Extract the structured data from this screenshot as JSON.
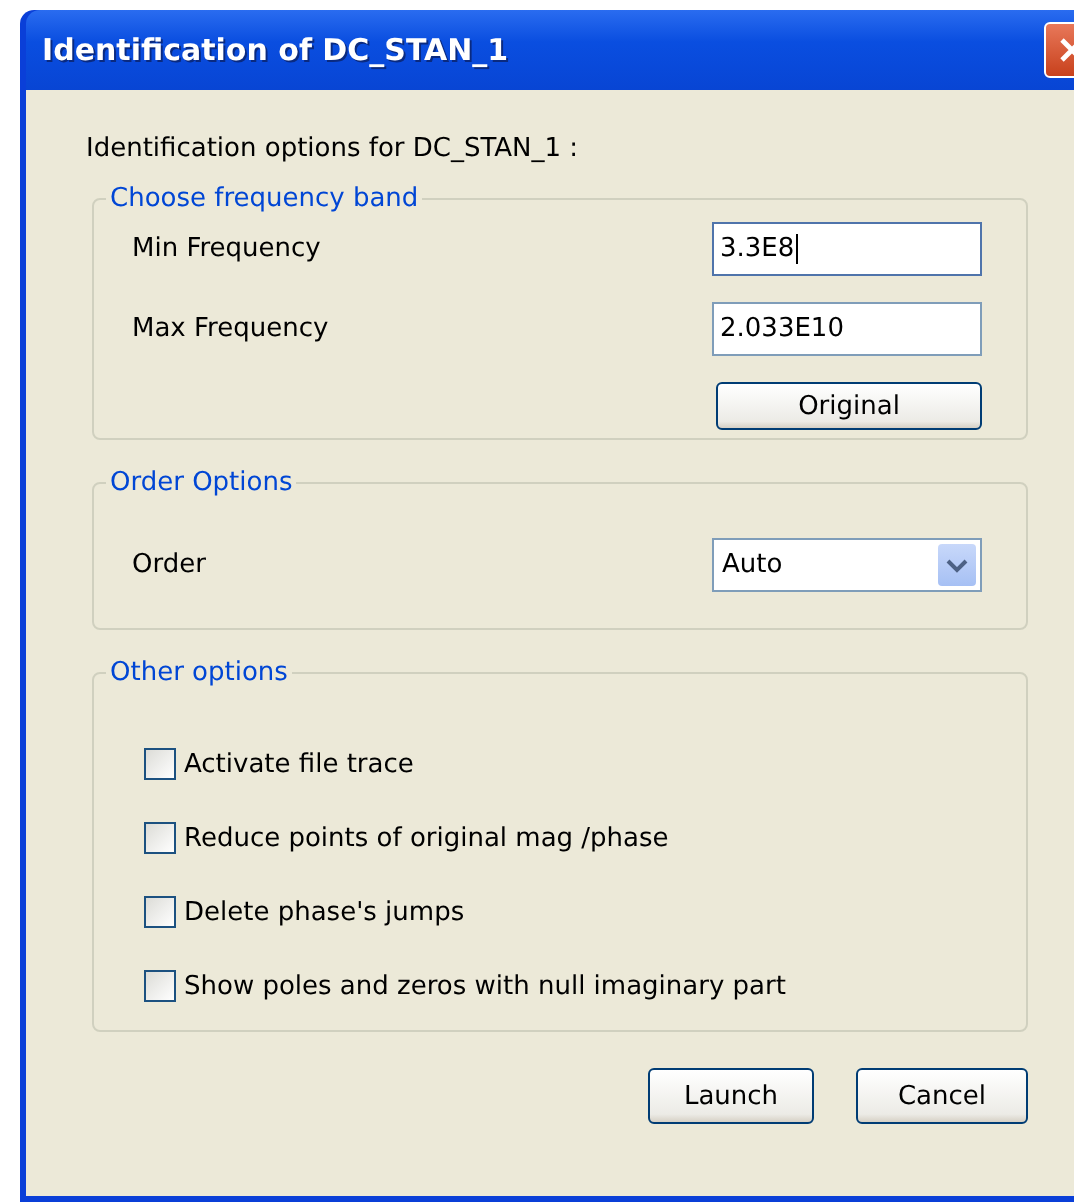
{
  "window": {
    "title": "Identification of DC_STAN_1"
  },
  "intro": "Identification options for DC_STAN_1 :",
  "frequency_band": {
    "legend": "Choose frequency band",
    "fields": [
      {
        "label": "Min Frequency",
        "value": "3.3E8",
        "focused": true
      },
      {
        "label": "Max Frequency",
        "value": "2.033E10",
        "focused": false
      }
    ],
    "button": "Original"
  },
  "order_options": {
    "legend": "Order Options",
    "label": "Order",
    "value": "Auto"
  },
  "other_options": {
    "legend": "Other options",
    "checkboxes": [
      {
        "label": "Activate file trace",
        "checked": false
      },
      {
        "label": "Reduce points of original mag /phase",
        "checked": false
      },
      {
        "label": "Delete phase's jumps",
        "checked": false
      },
      {
        "label": "Show poles and zeros with null imaginary part",
        "checked": false
      }
    ]
  },
  "buttons": [
    "Launch",
    "Cancel"
  ]
}
